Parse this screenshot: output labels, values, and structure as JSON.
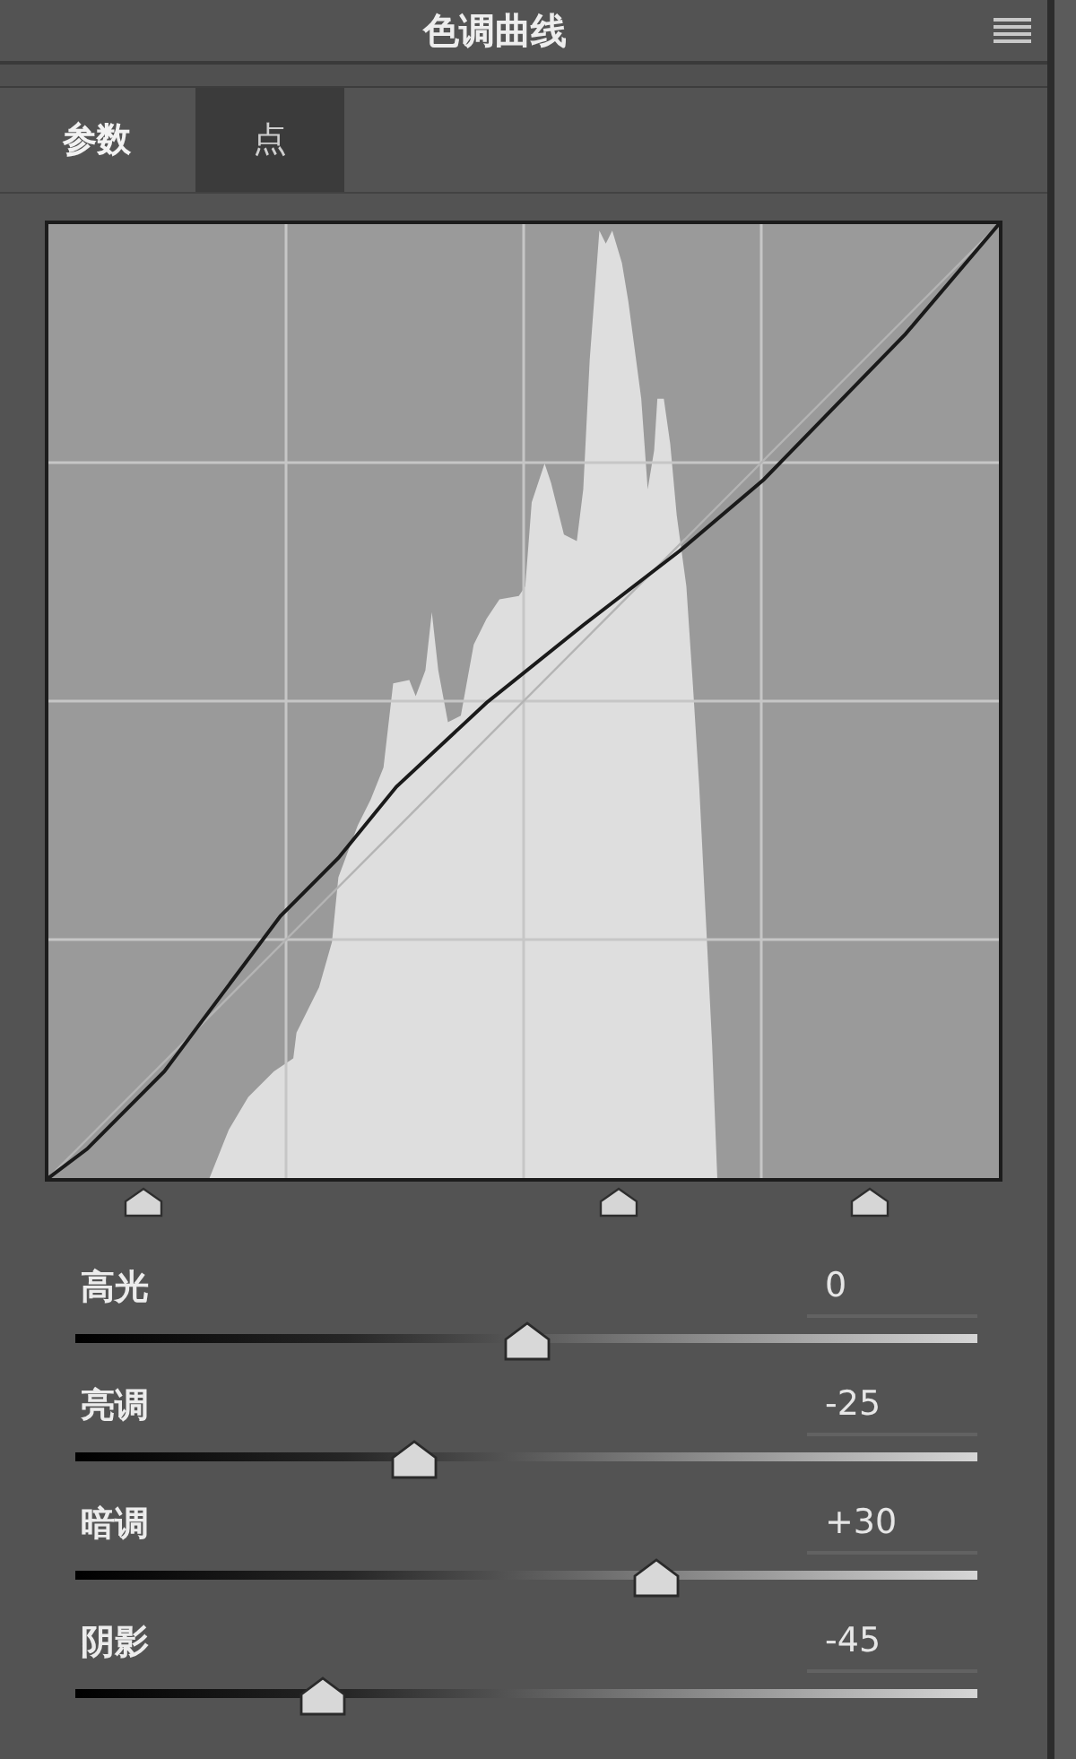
{
  "panel": {
    "title": "色调曲线"
  },
  "tabs": [
    {
      "label": "参数",
      "selected": true
    },
    {
      "label": "点",
      "selected": false
    }
  ],
  "curve": {
    "region_splits": [
      {
        "level": 0.1
      },
      {
        "level": 0.6
      },
      {
        "level": 0.865
      }
    ]
  },
  "sliders": [
    {
      "label": "高光",
      "value": "0",
      "level": 0.5
    },
    {
      "label": "亮调",
      "value": "-25",
      "level": 0.375
    },
    {
      "label": "暗调",
      "value": "+30",
      "level": 0.645
    },
    {
      "label": "阴影",
      "value": "-45",
      "level": 0.275
    }
  ]
}
